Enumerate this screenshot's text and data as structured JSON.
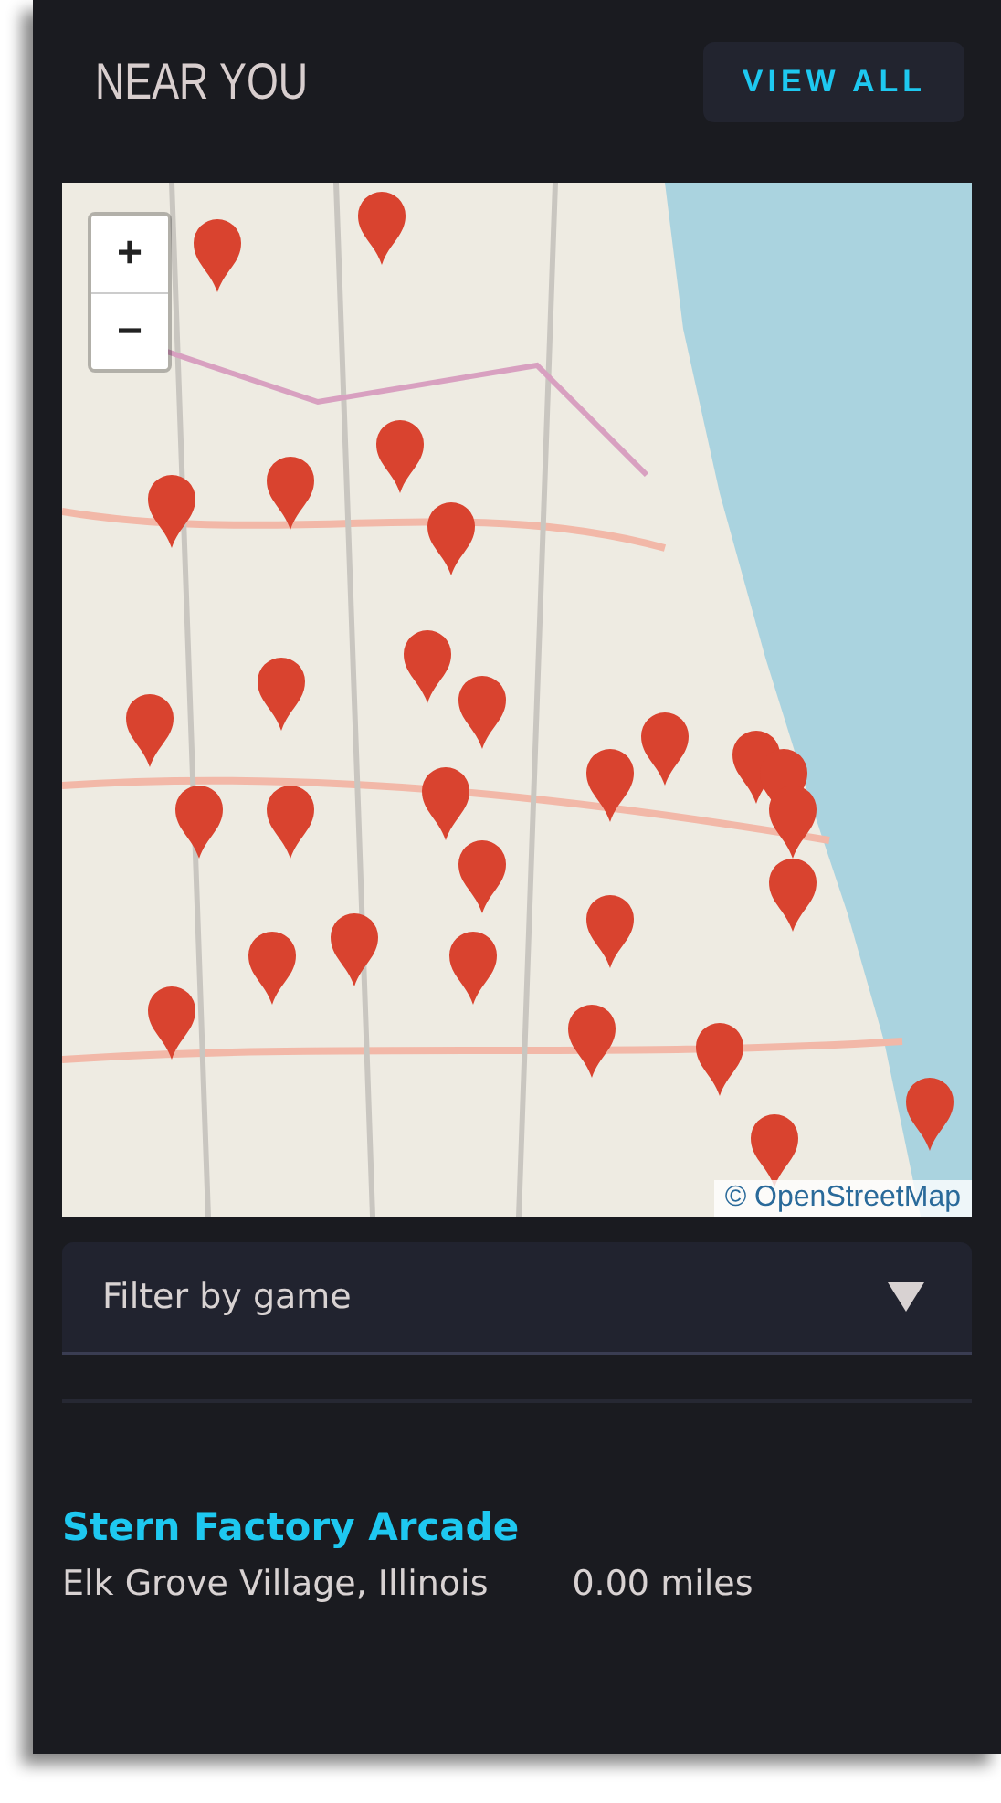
{
  "header": {
    "title": "NEAR YOU",
    "button": "VIEW ALL"
  },
  "map": {
    "kind": "picture",
    "zoom_in": "+",
    "zoom_out": "−",
    "attribution": "© OpenStreetMap"
  },
  "filter": {
    "placeholder": "Filter by game"
  },
  "locations": [
    {
      "name": "Stern Factory Arcade",
      "place": "Elk Grove Village, Illinois",
      "distance": "0.00 miles"
    }
  ]
}
